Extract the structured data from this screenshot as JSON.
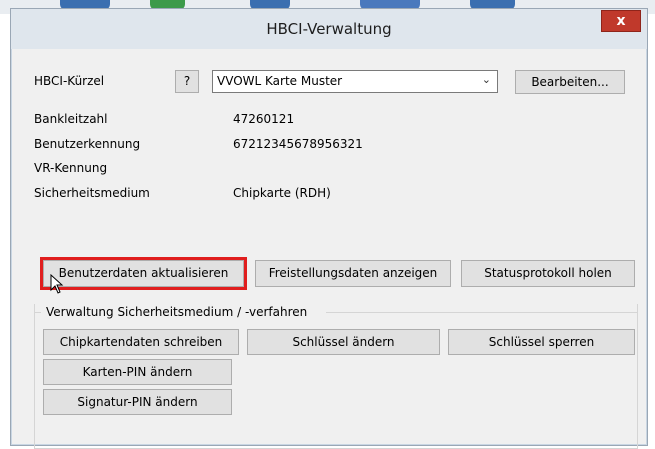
{
  "window": {
    "title": "HBCI-Verwaltung",
    "close_glyph": "x"
  },
  "header": {
    "kuerzel_label": "HBCI-Kürzel",
    "help_label": "?",
    "kuerzel_value": "VVOWL Karte Muster",
    "edit_label": "Bearbeiten..."
  },
  "fields": [
    {
      "label": "Bankleitzahl",
      "value": "47260121"
    },
    {
      "label": "Benutzerkennung",
      "value": "67212345678956321"
    },
    {
      "label": "VR-Kennung",
      "value": ""
    },
    {
      "label": "Sicherheitsmedium",
      "value": "Chipkarte  (RDH)"
    }
  ],
  "actions": {
    "update_user": "Benutzerdaten aktualisieren",
    "show_release": "Freistellungsdaten anzeigen",
    "fetch_status": "Statusprotokoll holen"
  },
  "security": {
    "group_title": "Verwaltung Sicherheitsmedium / -verfahren",
    "write_chip": "Chipkartendaten schreiben",
    "change_key": "Schlüssel ändern",
    "lock_key": "Schlüssel sperren",
    "change_card_pin": "Karten-PIN ändern",
    "change_sig_pin": "Signatur-PIN ändern"
  },
  "colors": {
    "highlight": "#e01e1e",
    "close": "#c0392b"
  }
}
